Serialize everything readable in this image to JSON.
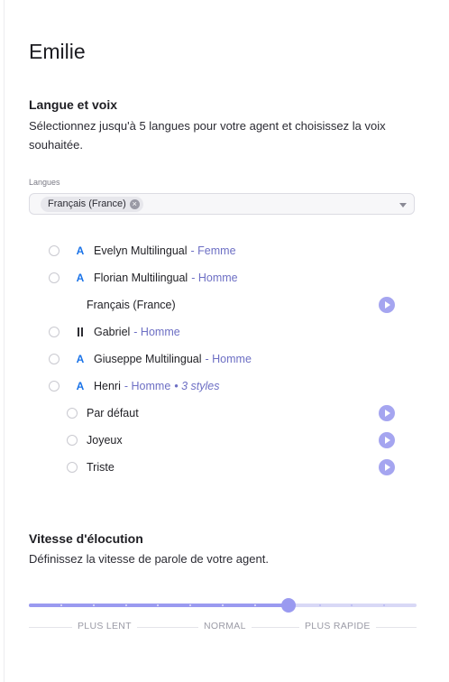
{
  "agent_name": "Emilie",
  "language_section": {
    "title": "Langue et voix",
    "description": "Sélectionnez jusqu'à 5 langues pour votre agent et choisissez la voix souhaitée.",
    "field_label": "Langues",
    "selected_language": "Français (France)"
  },
  "voices": [
    {
      "name": "Evelyn Multilingual",
      "gender": "- Femme",
      "provider_icon": "azure-icon"
    },
    {
      "name": "Florian Multilingual",
      "gender": "- Homme",
      "provider_icon": "azure-icon",
      "locale": "Français (France)"
    },
    {
      "name": "Gabriel",
      "gender": "- Homme",
      "provider_icon": "bars-icon"
    },
    {
      "name": "Giuseppe Multilingual",
      "gender": "- Homme",
      "provider_icon": "azure-icon"
    },
    {
      "name": "Henri",
      "gender": "- Homme",
      "styles": "• 3 styles",
      "provider_icon": "azure-icon",
      "style_options": [
        "Par défaut",
        "Joyeux",
        "Triste"
      ]
    }
  ],
  "speed_section": {
    "title": "Vitesse d'élocution",
    "description": "Définissez la vitesse de parole de votre agent.",
    "slider_value": 0.67,
    "tick_count": 13,
    "labels": {
      "slow": "PLUS LENT",
      "normal": "NORMAL",
      "fast": "PLUS RAPIDE"
    }
  },
  "colors": {
    "accent": "#9a9af0",
    "accent_light": "#d8d8f6",
    "gender_text": "#6d6fc4",
    "azure": "#1a73e8"
  }
}
